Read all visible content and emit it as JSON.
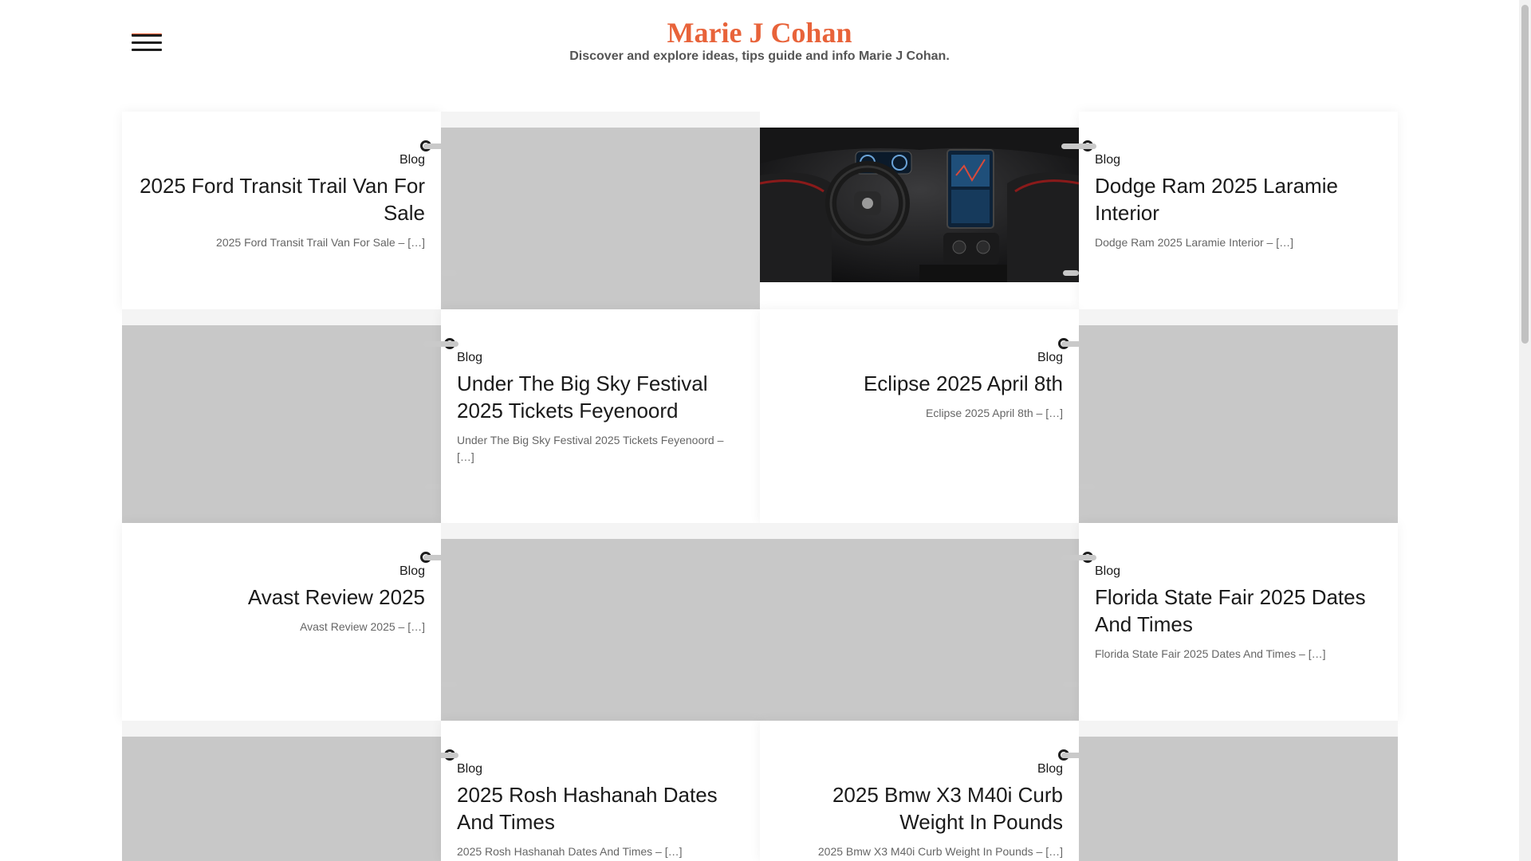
{
  "header": {
    "site_title": "Marie J Cohan",
    "tagline": "Discover and explore ideas, tips guide and info Marie J Cohan."
  },
  "posts": [
    {
      "category": "Blog",
      "title": "2025 Ford Transit Trail Van For Sale",
      "excerpt": "2025 Ford Transit Trail Van For Sale – […]"
    },
    {
      "category": "Blog",
      "title": "Dodge Ram 2025 Laramie Interior",
      "excerpt": "Dodge Ram 2025 Laramie Interior – […]"
    },
    {
      "category": "Blog",
      "title": "Under The Big Sky Festival 2025 Tickets Feyenoord",
      "excerpt": "Under The Big Sky Festival 2025 Tickets Feyenoord – […]"
    },
    {
      "category": "Blog",
      "title": "Eclipse 2025 April 8th",
      "excerpt": "Eclipse 2025 April 8th – […]"
    },
    {
      "category": "Blog",
      "title": "Avast Review 2025",
      "excerpt": "Avast Review 2025 – […]"
    },
    {
      "category": "Blog",
      "title": "Florida State Fair 2025 Dates And Times",
      "excerpt": "Florida State Fair 2025 Dates And Times – […]"
    },
    {
      "category": "Blog",
      "title": "2025 Rosh Hashanah Dates And Times",
      "excerpt": "2025 Rosh Hashanah Dates And Times – […]"
    },
    {
      "category": "Blog",
      "title": "2025 Bmw X3 M40i Curb Weight In Pounds",
      "excerpt": "2025 Bmw X3 M40i Curb Weight In Pounds – […]"
    }
  ],
  "icons": {
    "menu": "hamburger-menu-icon"
  },
  "colors": {
    "accent": "#e8633a",
    "text": "#1a1a1a",
    "muted": "#666666",
    "placeholder": "#c8c8c8"
  }
}
